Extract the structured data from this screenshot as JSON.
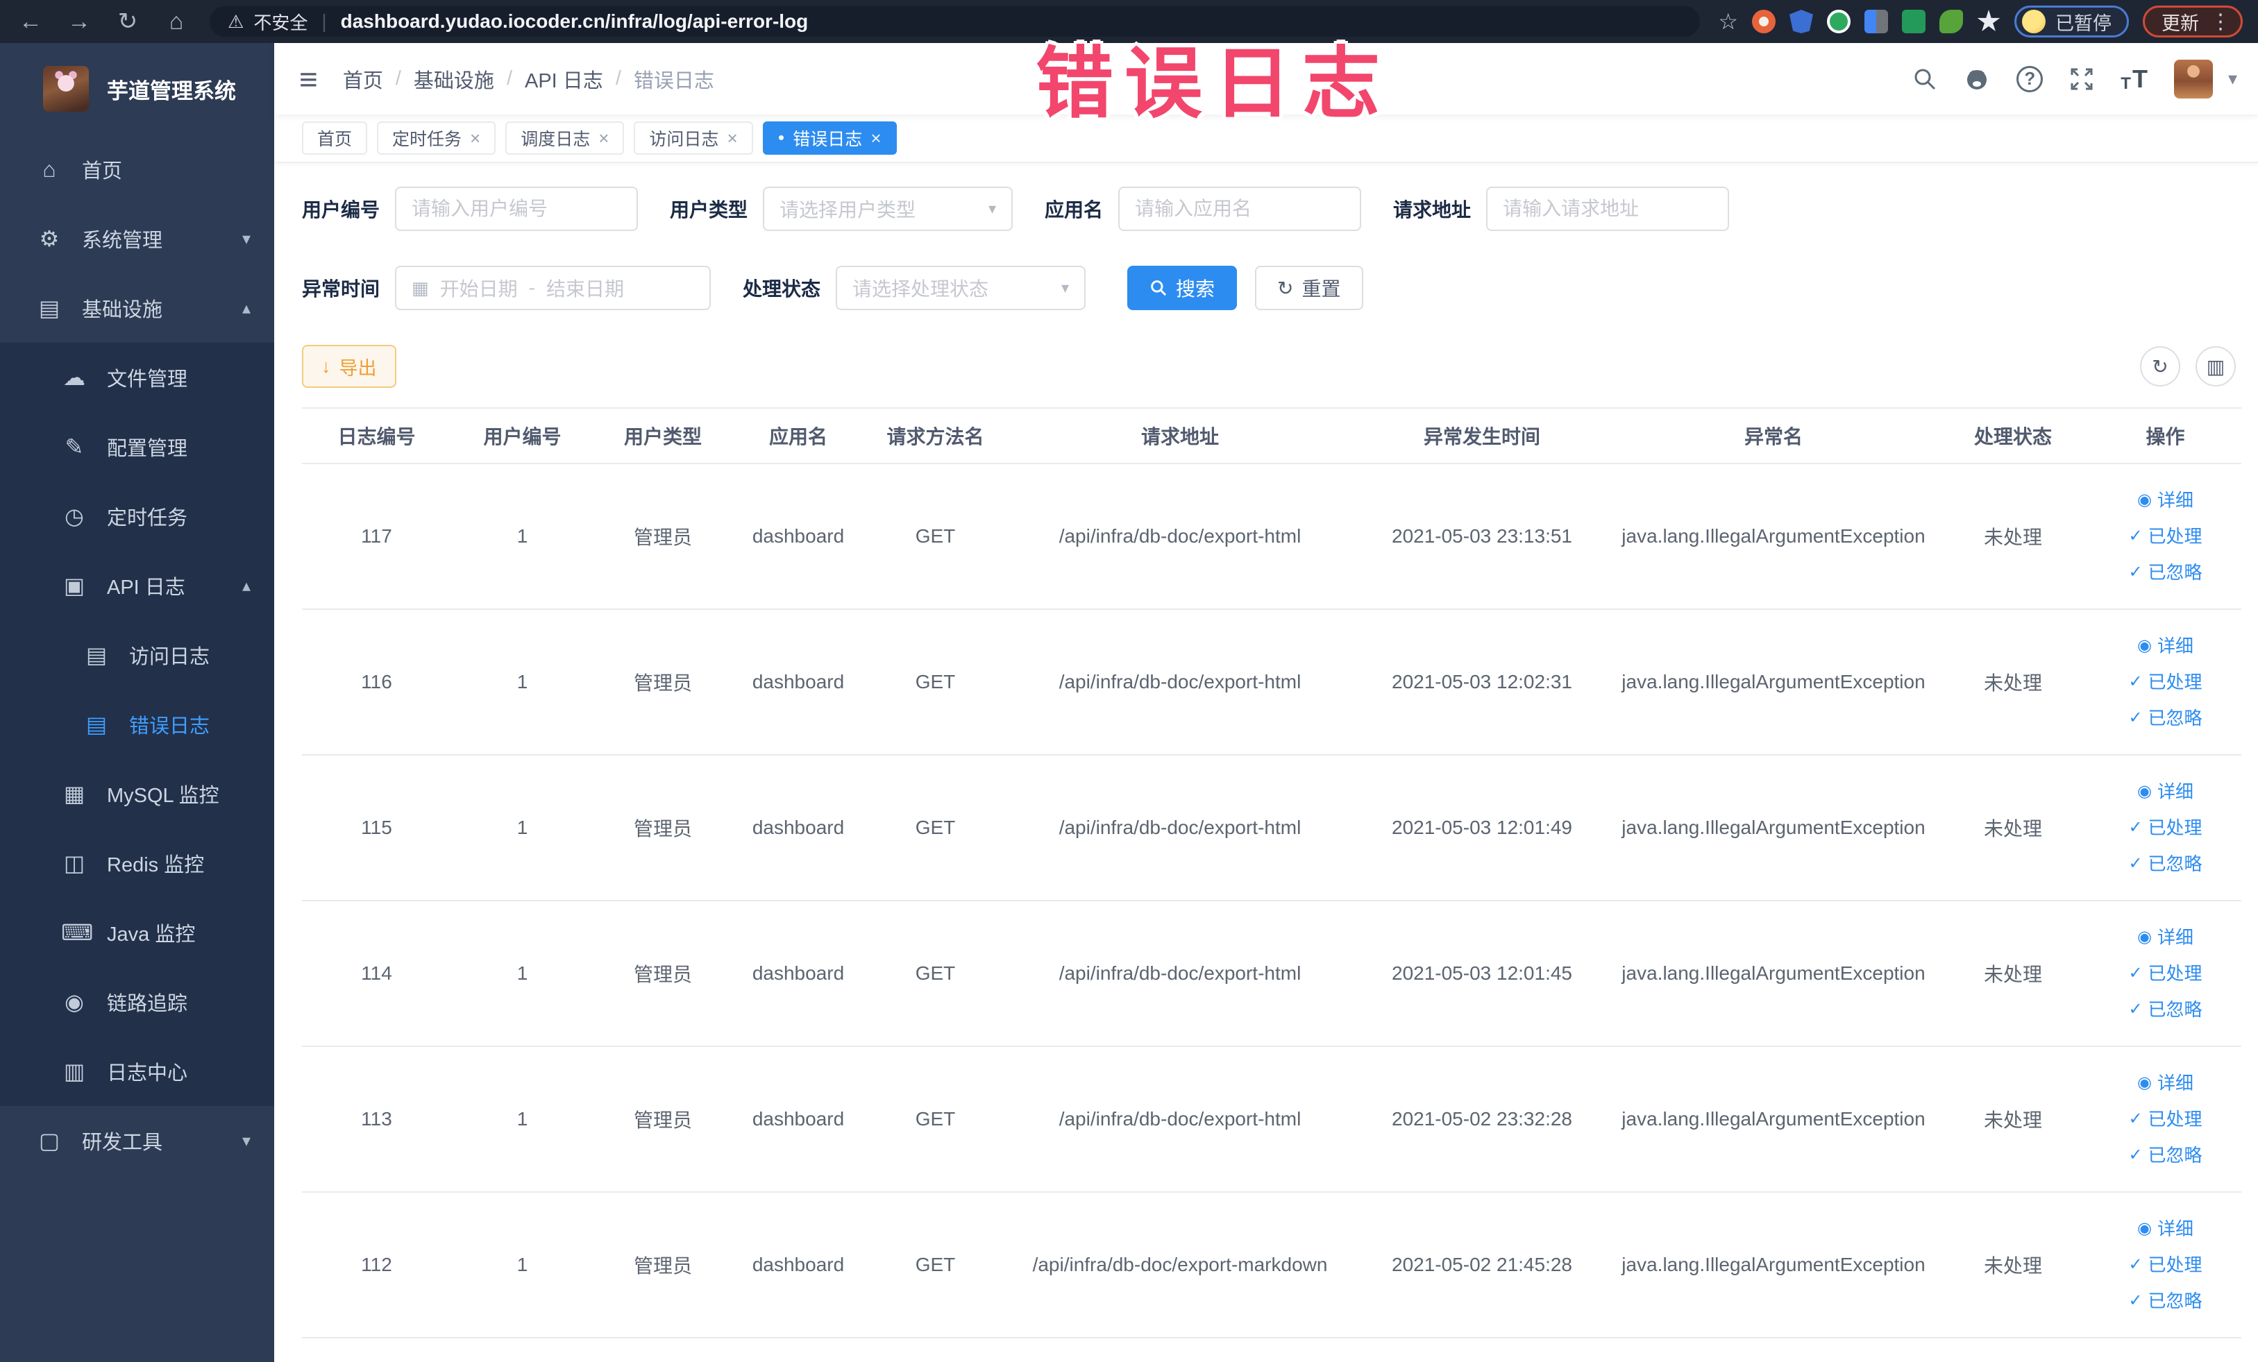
{
  "overlay_label": "错误日志",
  "browser": {
    "security_warning": "不安全",
    "url": "dashboard.yudao.iocoder.cn/infra/log/api-error-log",
    "paused_badge": "已暂停",
    "update_button": "更新"
  },
  "icons": {
    "back": "←",
    "forward": "→",
    "reload": "↻",
    "home": "⌂",
    "warning": "⚠",
    "star": "☆",
    "dots": "⋮",
    "hamburger": "≡",
    "caret_down": "▾",
    "help": "?",
    "font_small": "T",
    "font_big": "T",
    "close": "×",
    "tab_dot": "●",
    "calendar": "▦",
    "select_arrow": "▾",
    "reset": "↻",
    "export": "↓",
    "refresh": "↻",
    "columns": "▥",
    "eye": "◉",
    "check": "✓",
    "divider": "|"
  },
  "sidebar": {
    "app_title": "芋道管理系统",
    "items": [
      {
        "label": "首页",
        "icon": "⌂"
      },
      {
        "label": "系统管理",
        "icon": "⚙",
        "chevron": "▾"
      },
      {
        "label": "基础设施",
        "icon": "▤",
        "chevron": "▴"
      },
      {
        "label": "文件管理",
        "icon": "☁"
      },
      {
        "label": "配置管理",
        "icon": "✎"
      },
      {
        "label": "定时任务",
        "icon": "◷"
      },
      {
        "label": "API 日志",
        "icon": "▣",
        "chevron": "▴"
      },
      {
        "label": "访问日志",
        "icon": "▤"
      },
      {
        "label": "错误日志",
        "icon": "▤"
      },
      {
        "label": "MySQL 监控",
        "icon": "▦"
      },
      {
        "label": "Redis 监控",
        "icon": "◫"
      },
      {
        "label": "Java 监控",
        "icon": "⌨"
      },
      {
        "label": "链路追踪",
        "icon": "◉"
      },
      {
        "label": "日志中心",
        "icon": "▥"
      },
      {
        "label": "研发工具",
        "icon": "▢",
        "chevron": "▾"
      }
    ]
  },
  "header": {
    "breadcrumb": [
      "首页",
      "基础设施",
      "API 日志",
      "错误日志"
    ],
    "separator": "/"
  },
  "tabs": [
    {
      "label": "首页"
    },
    {
      "label": "定时任务"
    },
    {
      "label": "调度日志"
    },
    {
      "label": "访问日志"
    },
    {
      "label": "错误日志"
    }
  ],
  "filters": {
    "user_id_label": "用户编号",
    "user_id_placeholder": "请输入用户编号",
    "user_type_label": "用户类型",
    "user_type_placeholder": "请选择用户类型",
    "app_name_label": "应用名",
    "app_name_placeholder": "请输入应用名",
    "request_url_label": "请求地址",
    "request_url_placeholder": "请输入请求地址",
    "exception_time_label": "异常时间",
    "start_date_placeholder": "开始日期",
    "date_separator": "-",
    "end_date_placeholder": "结束日期",
    "process_status_label": "处理状态",
    "process_status_placeholder": "请选择处理状态",
    "search_button": "搜索",
    "reset_button": "重置"
  },
  "toolbar": {
    "export_button": "导出"
  },
  "table": {
    "columns": [
      "日志编号",
      "用户编号",
      "用户类型",
      "应用名",
      "请求方法名",
      "请求地址",
      "异常发生时间",
      "异常名",
      "处理状态",
      "操作"
    ],
    "actions": {
      "detail": "详细",
      "processed": "已处理",
      "ignored": "已忽略"
    },
    "rows": [
      {
        "id": "117",
        "user_id": "1",
        "user_type": "管理员",
        "app": "dashboard",
        "method": "GET",
        "url": "/api/infra/db-doc/export-html",
        "time": "2021-05-03 23:13:51",
        "exception": "java.lang.IllegalArgumentException",
        "status": "未处理"
      },
      {
        "id": "116",
        "user_id": "1",
        "user_type": "管理员",
        "app": "dashboard",
        "method": "GET",
        "url": "/api/infra/db-doc/export-html",
        "time": "2021-05-03 12:02:31",
        "exception": "java.lang.IllegalArgumentException",
        "status": "未处理"
      },
      {
        "id": "115",
        "user_id": "1",
        "user_type": "管理员",
        "app": "dashboard",
        "method": "GET",
        "url": "/api/infra/db-doc/export-html",
        "time": "2021-05-03 12:01:49",
        "exception": "java.lang.IllegalArgumentException",
        "status": "未处理"
      },
      {
        "id": "114",
        "user_id": "1",
        "user_type": "管理员",
        "app": "dashboard",
        "method": "GET",
        "url": "/api/infra/db-doc/export-html",
        "time": "2021-05-03 12:01:45",
        "exception": "java.lang.IllegalArgumentException",
        "status": "未处理"
      },
      {
        "id": "113",
        "user_id": "1",
        "user_type": "管理员",
        "app": "dashboard",
        "method": "GET",
        "url": "/api/infra/db-doc/export-html",
        "time": "2021-05-02 23:32:28",
        "exception": "java.lang.IllegalArgumentException",
        "status": "未处理"
      },
      {
        "id": "112",
        "user_id": "1",
        "user_type": "管理员",
        "app": "dashboard",
        "method": "GET",
        "url": "/api/infra/db-doc/export-markdown",
        "time": "2021-05-02 21:45:28",
        "exception": "java.lang.IllegalArgumentException",
        "status": "未处理"
      }
    ]
  },
  "colors": {
    "primary": "#2d8cf0",
    "warning_button": "#ef9f35",
    "active_menu": "#409eff",
    "sidebar_bg": "#2d3b54",
    "sidebar_submenu_bg": "#22304a",
    "browser_bar_bg": "#1e2634",
    "annotation_red": "#f2466c"
  }
}
